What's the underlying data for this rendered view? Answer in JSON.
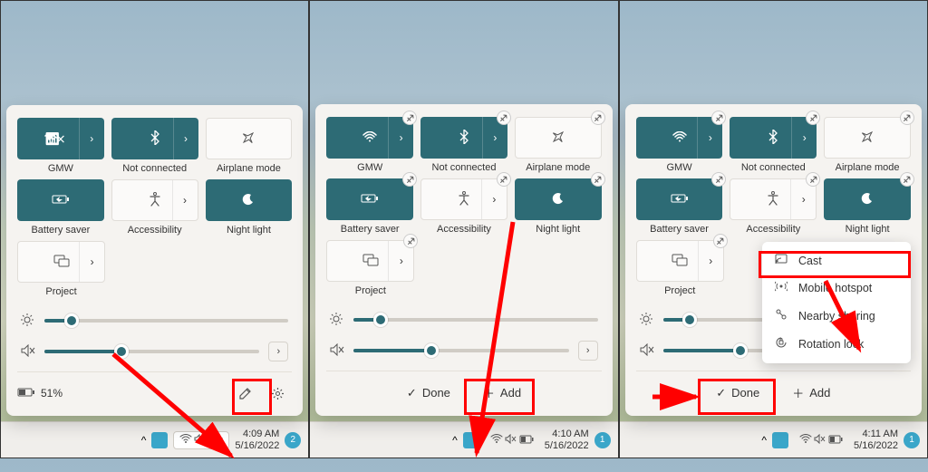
{
  "tiles": {
    "wifi": {
      "label": "GMW"
    },
    "bluetooth": {
      "label": "Not connected"
    },
    "airplane": {
      "label": "Airplane mode"
    },
    "battery_saver": {
      "label": "Battery saver"
    },
    "accessibility": {
      "label": "Accessibility"
    },
    "night_light": {
      "label": "Night light"
    },
    "project": {
      "label": "Project"
    }
  },
  "sliders": {
    "brightness": {
      "percent": 11
    },
    "volume": {
      "percent": 36
    }
  },
  "footer": {
    "battery_text": "51%"
  },
  "edit_bar": {
    "done": "Done",
    "add": "Add"
  },
  "popup": {
    "cast": "Cast",
    "mobile_hotspot": "Mobile hotspot",
    "nearby_sharing": "Nearby sharing",
    "rotation_lock": "Rotation lock"
  },
  "taskbar": {
    "frames": [
      {
        "time": "4:09 AM",
        "date": "5/16/2022",
        "notif": "2"
      },
      {
        "time": "4:10 AM",
        "date": "5/16/2022",
        "notif": "1"
      },
      {
        "time": "4:11 AM",
        "date": "5/16/2022",
        "notif": "1"
      }
    ]
  }
}
